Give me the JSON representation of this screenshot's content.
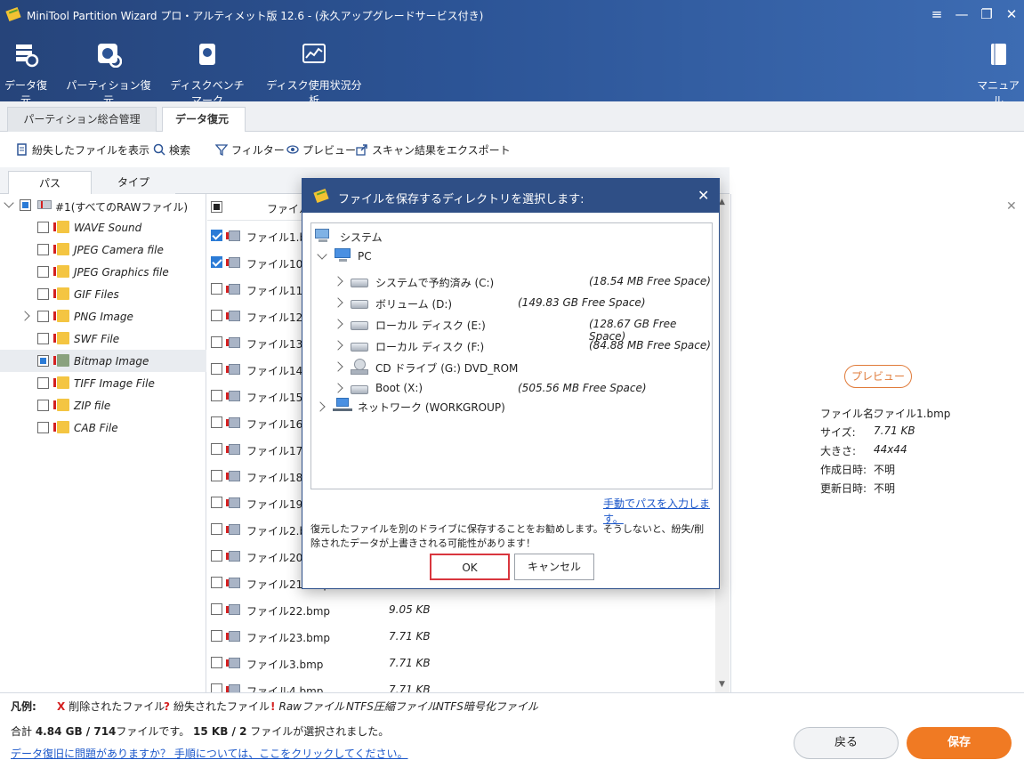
{
  "app": {
    "title": "MiniTool Partition Wizard プロ・アルティメット版 12.6 - (永久アップグレードサービス付き)",
    "window_controls": [
      "menu-icon",
      "minimize-icon",
      "restore-icon",
      "close-icon"
    ]
  },
  "toolbar": {
    "items": [
      {
        "label": "データ復元",
        "icon": "data-recovery-icon"
      },
      {
        "label": "パーティション復元",
        "icon": "partition-recovery-icon"
      },
      {
        "label": "ディスクベンチマーク",
        "icon": "disk-benchmark-icon"
      },
      {
        "label": "ディスク使用状況分析",
        "icon": "space-analyzer-icon"
      }
    ],
    "manual_label": "マニュアル"
  },
  "tabs": [
    {
      "label": "パーティション総合管理",
      "active": false
    },
    {
      "label": "データ復元",
      "active": true,
      "closable": true
    }
  ],
  "actions": [
    {
      "label": "紛失したファイルを表示",
      "icon": "lost-file-icon"
    },
    {
      "label": "検索",
      "icon": "search-icon"
    },
    {
      "label": "フィルター",
      "icon": "filter-icon"
    },
    {
      "label": "プレビュー",
      "icon": "eye-icon"
    },
    {
      "label": "スキャン結果をエクスポート",
      "icon": "export-icon"
    }
  ],
  "subtabs": [
    "パス",
    "タイプ"
  ],
  "tree": {
    "root": "#1(すべてのRAWファイル)",
    "items": [
      {
        "label": "WAVE Sound",
        "checked": false,
        "expandable": false,
        "selected": false
      },
      {
        "label": "JPEG Camera file",
        "checked": false,
        "expandable": false,
        "selected": false
      },
      {
        "label": "JPEG Graphics file",
        "checked": false,
        "expandable": false,
        "selected": false
      },
      {
        "label": "GIF Files",
        "checked": false,
        "expandable": false,
        "selected": false
      },
      {
        "label": "PNG Image",
        "checked": false,
        "expandable": true,
        "selected": false
      },
      {
        "label": "SWF File",
        "checked": false,
        "expandable": false,
        "selected": false
      },
      {
        "label": "Bitmap Image",
        "checked": "partial",
        "expandable": false,
        "selected": true
      },
      {
        "label": "TIFF Image File",
        "checked": false,
        "expandable": false,
        "selected": false
      },
      {
        "label": "ZIP file",
        "checked": false,
        "expandable": false,
        "selected": false
      },
      {
        "label": "CAB File",
        "checked": false,
        "expandable": false,
        "selected": false
      }
    ]
  },
  "filelist": {
    "header_name": "ファイル名",
    "rows": [
      {
        "name": "ファイル1.bmp",
        "size": "",
        "checked": true
      },
      {
        "name": "ファイル10.bmp",
        "size": "",
        "checked": true
      },
      {
        "name": "ファイル11.bmp",
        "size": "",
        "checked": false
      },
      {
        "name": "ファイル12.bmp",
        "size": "",
        "checked": false
      },
      {
        "name": "ファイル13.bmp",
        "size": "",
        "checked": false
      },
      {
        "name": "ファイル14.bmp",
        "size": "",
        "checked": false
      },
      {
        "name": "ファイル15.bmp",
        "size": "",
        "checked": false
      },
      {
        "name": "ファイル16.bmp",
        "size": "",
        "checked": false
      },
      {
        "name": "ファイル17.bmp",
        "size": "",
        "checked": false
      },
      {
        "name": "ファイル18.bmp",
        "size": "",
        "checked": false
      },
      {
        "name": "ファイル19.bmp",
        "size": "",
        "checked": false
      },
      {
        "name": "ファイル2.bmp",
        "size": "",
        "checked": false
      },
      {
        "name": "ファイル20.bmp",
        "size": "",
        "checked": false
      },
      {
        "name": "ファイル21.bmp",
        "size": "",
        "checked": false
      },
      {
        "name": "ファイル22.bmp",
        "size": "9.05 KB",
        "checked": false
      },
      {
        "name": "ファイル23.bmp",
        "size": "7.71 KB",
        "checked": false
      },
      {
        "name": "ファイル3.bmp",
        "size": "7.71 KB",
        "checked": false
      },
      {
        "name": "ファイル4.bmp",
        "size": "7.71 KB",
        "checked": false
      }
    ]
  },
  "preview_panel": {
    "preview_button": "プレビュー",
    "info": [
      {
        "key": "ファイル名:",
        "value": "ファイル1.bmp"
      },
      {
        "key": "サイズ:",
        "value": "7.71 KB"
      },
      {
        "key": "大きさ:",
        "value": "44x44"
      },
      {
        "key": "作成日時:",
        "value": "不明"
      },
      {
        "key": "更新日時:",
        "value": "不明"
      }
    ]
  },
  "legend": {
    "title": "凡例:",
    "items": [
      {
        "mark": "X",
        "label": "削除されたファイル",
        "color": "#d42020"
      },
      {
        "mark": "?",
        "label": "紛失されたファイル",
        "color": "#d42020"
      },
      {
        "mark": "!",
        "label": "Rawファイル",
        "color": "#d42020"
      },
      {
        "mark": "",
        "label": "NTFS圧縮ファイル",
        "color": "#222222"
      },
      {
        "mark": "",
        "label": "NTFS暗号化ファイル",
        "color": "#222222"
      }
    ]
  },
  "summary": {
    "prefix": "合計 ",
    "total": "4.84 GB / 714",
    "mid": "ファイルです。 ",
    "selected": "15 KB / 2",
    "suffix": " ファイルが選択されました。"
  },
  "help_link": "データ復旧に問題がありますか？ 手順については、ここをクリックしてください。",
  "buttons": {
    "back": "戻る",
    "save": "保存"
  },
  "dialog": {
    "title": "ファイルを保存するディレクトリを選択します:",
    "tree": {
      "system": "システム",
      "pc": "PC",
      "drives": [
        {
          "name": "システムで予約済み (C:)",
          "free": "(18.54 MB Free Space)"
        },
        {
          "name": "ボリューム (D:)",
          "free": "(149.83 GB Free Space)"
        },
        {
          "name": "ローカル ディスク (E:)",
          "free": "(128.67 GB Free Space)"
        },
        {
          "name": "ローカル ディスク (F:)",
          "free": "(84.88 MB Free Space)"
        },
        {
          "name": "CD ドライブ (G:) DVD_ROM",
          "free": ""
        },
        {
          "name": "Boot (X:)",
          "free": "(505.56 MB Free Space)"
        }
      ],
      "network": "ネットワーク (WORKGROUP)"
    },
    "manual_link": "手動でパスを入力します。",
    "warning": "復元したファイルを別のドライブに保存することをお勧めします。そうしないと、紛失/削除されたデータが上書きされる可能性があります！",
    "ok": "OK",
    "cancel": "キャンセル"
  },
  "colors": {
    "accent": "#f07a23",
    "title_bar": "#2f4f86",
    "link": "#1a56c9"
  }
}
